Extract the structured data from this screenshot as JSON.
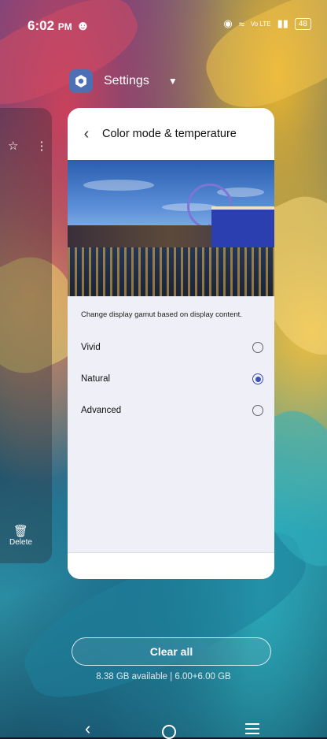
{
  "status_bar": {
    "time": "6:02",
    "ampm": "PM",
    "network_label": "Vo LTE",
    "battery": "48"
  },
  "recent_app": {
    "name": "Settings",
    "icon": "gear-icon"
  },
  "side_card": {
    "delete_label": "Delete"
  },
  "settings_page": {
    "title": "Color mode & temperature",
    "description": "Change display gamut based on display content.",
    "options": [
      {
        "label": "Vivid",
        "selected": false
      },
      {
        "label": "Natural",
        "selected": true
      },
      {
        "label": "Advanced",
        "selected": false
      }
    ]
  },
  "recents": {
    "clear_all_label": "Clear all",
    "memory_info": "8.38 GB available | 6.00+6.00 GB"
  },
  "colors": {
    "accent": "#3d4fb8",
    "card_bg": "#eeeff7",
    "app_icon_bg": "#4d6fb3"
  }
}
